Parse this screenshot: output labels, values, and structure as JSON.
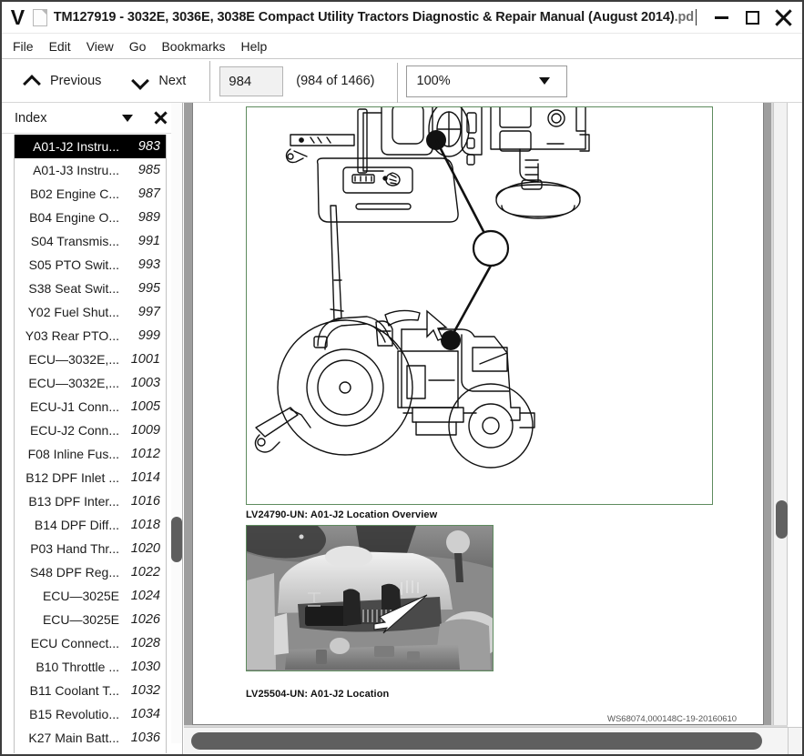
{
  "window": {
    "logo_letter": "V",
    "title": "TM127919 - 3032E, 3036E, 3038E Compact Utility Tractors Diagnostic & Repair Manual (August 2014)",
    "title_extension": ".pdf",
    "controls": {
      "minimize": "minimize-button",
      "maximize": "maximize-button",
      "close": "close-button"
    }
  },
  "menubar": {
    "items": [
      {
        "label": "File"
      },
      {
        "label": "Edit"
      },
      {
        "label": "View"
      },
      {
        "label": "Go"
      },
      {
        "label": "Bookmarks"
      },
      {
        "label": "Help"
      }
    ]
  },
  "toolbar": {
    "previous_label": "Previous",
    "next_label": "Next",
    "page_value": "984",
    "page_placeholder": "984",
    "page_count_text": "(984 of 1466)",
    "current_page": 984,
    "total_pages": 1466,
    "zoom_value": "100%"
  },
  "sidebar": {
    "title": "Index",
    "selected_index": 0,
    "items": [
      {
        "label": "A01-J2 Instru...",
        "page": "983"
      },
      {
        "label": "A01-J3 Instru...",
        "page": "985"
      },
      {
        "label": "B02 Engine C...",
        "page": "987"
      },
      {
        "label": "B04 Engine O...",
        "page": "989"
      },
      {
        "label": "S04 Transmis...",
        "page": "991"
      },
      {
        "label": "S05 PTO Swit...",
        "page": "993"
      },
      {
        "label": "S38 Seat Swit...",
        "page": "995"
      },
      {
        "label": "Y02 Fuel Shut...",
        "page": "997"
      },
      {
        "label": "Y03 Rear PTO...",
        "page": "999"
      },
      {
        "label": "ECU—3032E,...",
        "page": "1001"
      },
      {
        "label": "ECU—3032E,...",
        "page": "1003"
      },
      {
        "label": "ECU-J1 Conn...",
        "page": "1005"
      },
      {
        "label": "ECU-J2 Conn...",
        "page": "1009"
      },
      {
        "label": "F08 Inline Fus...",
        "page": "1012"
      },
      {
        "label": "B12 DPF Inlet ...",
        "page": "1014"
      },
      {
        "label": "B13 DPF Inter...",
        "page": "1016"
      },
      {
        "label": "B14 DPF Diff...",
        "page": "1018"
      },
      {
        "label": "P03 Hand Thr...",
        "page": "1020"
      },
      {
        "label": "S48 DPF Reg...",
        "page": "1022"
      },
      {
        "label": "ECU—3025E",
        "page": "1024"
      },
      {
        "label": "ECU—3025E",
        "page": "1026"
      },
      {
        "label": "ECU Connect...",
        "page": "1028"
      },
      {
        "label": "B10 Throttle ...",
        "page": "1030"
      },
      {
        "label": "B11 Coolant T...",
        "page": "1032"
      },
      {
        "label": "B15 Revolutio...",
        "page": "1034"
      },
      {
        "label": "K27 Main Batt...",
        "page": "1036"
      }
    ]
  },
  "document": {
    "figure1_caption": "LV24790-UN: A01-J2 Location Overview",
    "figure2_caption": "LV25504-UN: A01-J2 Location",
    "footer_code": "WS68074,000148C-19-20160610"
  },
  "colors": {
    "figure_border": "#5e8b5e",
    "selection_background": "#000000",
    "selection_text": "#ffffff",
    "scrollbar_thumb": "#5f5f5f",
    "page_background": "#ffffff"
  }
}
